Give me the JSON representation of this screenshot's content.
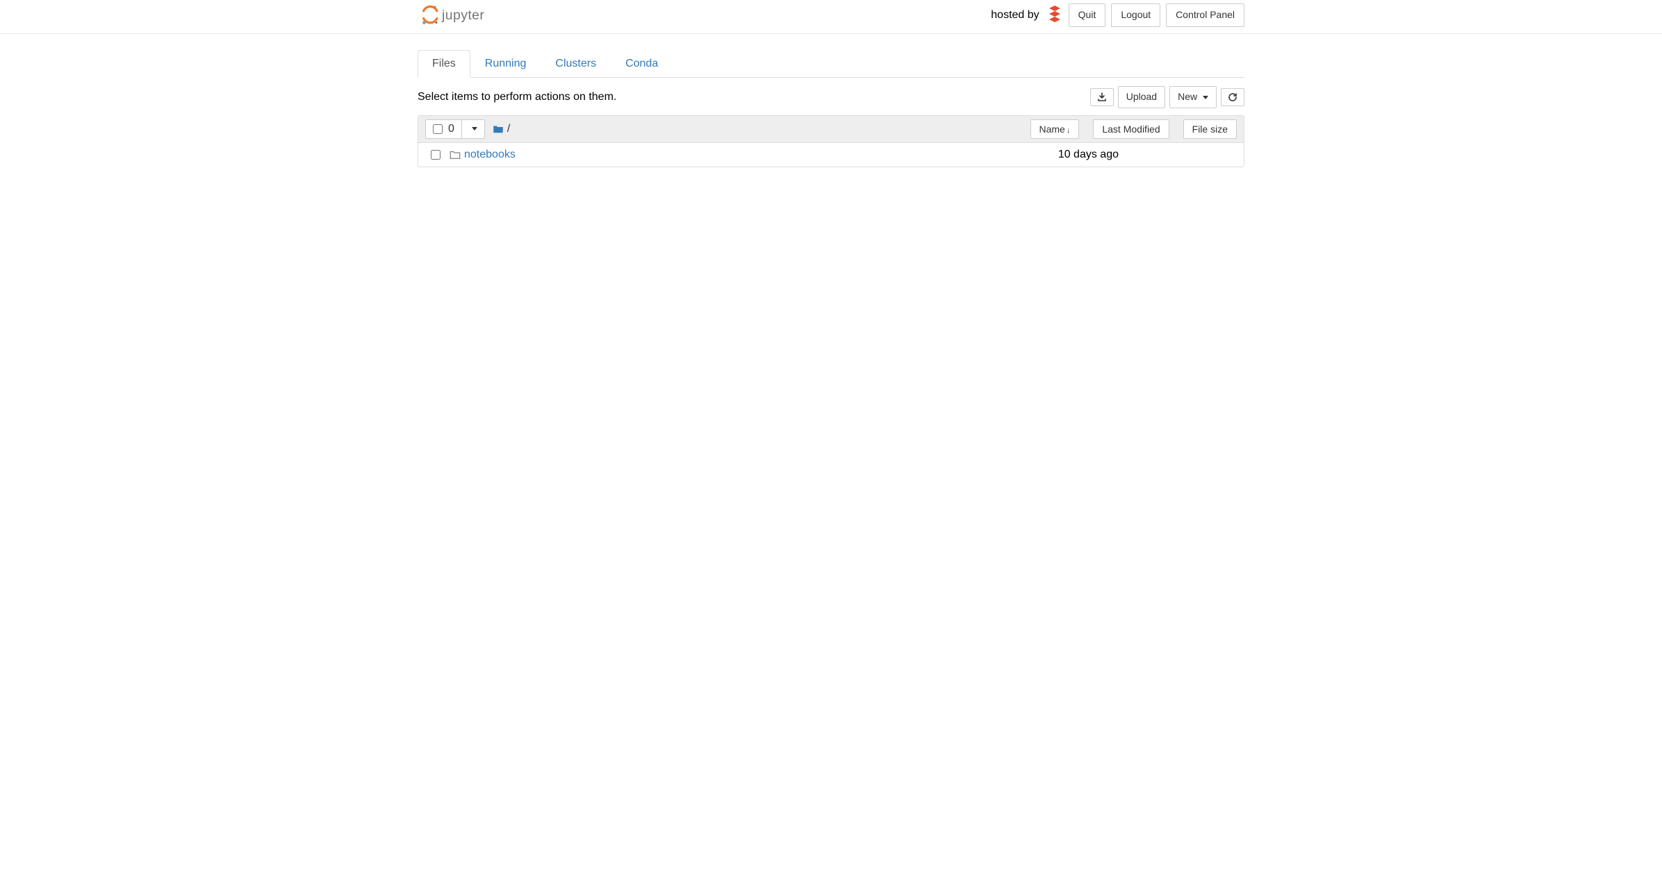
{
  "header": {
    "logo_text": "jupyter",
    "hosted_by": "hosted by",
    "quit_label": "Quit",
    "logout_label": "Logout",
    "control_panel_label": "Control Panel"
  },
  "tabs": [
    {
      "id": "files",
      "label": "Files",
      "active": true
    },
    {
      "id": "running",
      "label": "Running",
      "active": false
    },
    {
      "id": "clusters",
      "label": "Clusters",
      "active": false
    },
    {
      "id": "conda",
      "label": "Conda",
      "active": false
    }
  ],
  "toolbar": {
    "hint": "Select items to perform actions on them.",
    "upload_label": "Upload",
    "new_label": "New"
  },
  "list_header": {
    "selected_count": "0",
    "breadcrumb_sep": "/",
    "name_col": "Name",
    "modified_col": "Last Modified",
    "size_col": "File size"
  },
  "items": [
    {
      "name": "notebooks",
      "modified": "10 days ago",
      "size": ""
    }
  ]
}
